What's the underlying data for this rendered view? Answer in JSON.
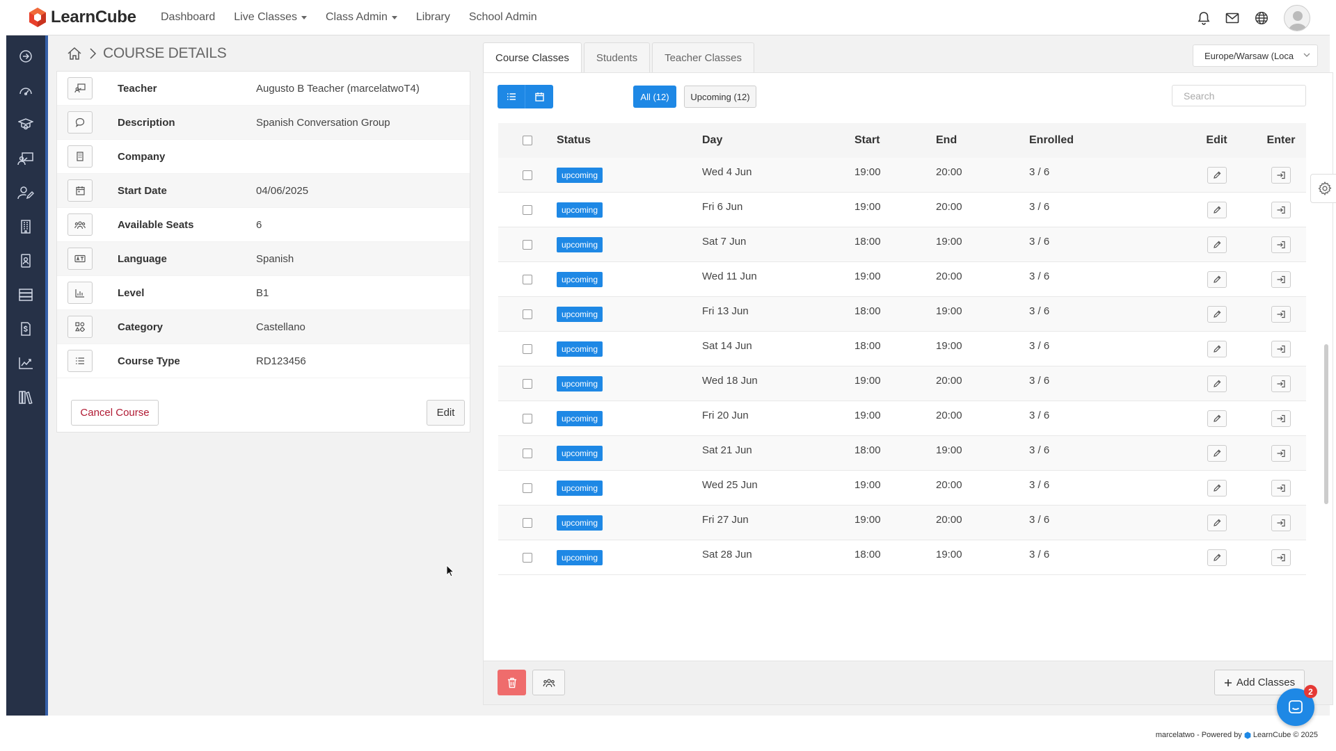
{
  "app": {
    "brand": "LearnCube",
    "accent": "#1e88e5",
    "sidebar_bg": "#263147"
  },
  "nav": {
    "items": [
      {
        "label": "Dashboard",
        "dropdown": false
      },
      {
        "label": "Live Classes",
        "dropdown": true
      },
      {
        "label": "Class Admin",
        "dropdown": true
      },
      {
        "label": "Library",
        "dropdown": false
      },
      {
        "label": "School Admin",
        "dropdown": false
      }
    ]
  },
  "top_icons": [
    "bell-icon",
    "mail-icon",
    "globe-icon",
    "avatar"
  ],
  "sidebar": {
    "icons": [
      "arrow-right-circle-icon",
      "dashboard-gauge-icon",
      "graduation-cap-icon",
      "teacher-board-icon",
      "user-edit-icon",
      "building-icon",
      "id-badge-icon",
      "server-list-icon",
      "dollar-document-icon",
      "chart-line-icon",
      "library-books-icon"
    ]
  },
  "breadcrumb": {
    "title": "COURSE DETAILS"
  },
  "details": {
    "rows": [
      {
        "icon": "teacher-icon",
        "label": "Teacher",
        "value": "Augusto B Teacher (marcelatwoT4)"
      },
      {
        "icon": "speech-bubble-icon",
        "label": "Description",
        "value": "Spanish Conversation Group"
      },
      {
        "icon": "building-icon",
        "label": "Company",
        "value": ""
      },
      {
        "icon": "calendar-icon",
        "label": "Start Date",
        "value": "04/06/2025"
      },
      {
        "icon": "group-icon",
        "label": "Available Seats",
        "value": "6"
      },
      {
        "icon": "language-icon",
        "label": "Language",
        "value": "Spanish"
      },
      {
        "icon": "bar-chart-icon",
        "label": "Level",
        "value": "B1"
      },
      {
        "icon": "category-icon",
        "label": "Category",
        "value": "Castellano"
      },
      {
        "icon": "list-icon",
        "label": "Course Type",
        "value": "RD123456"
      }
    ],
    "cancel_label": "Cancel Course",
    "edit_label": "Edit"
  },
  "tabs": [
    {
      "label": "Course Classes",
      "active": true
    },
    {
      "label": "Students",
      "active": false
    },
    {
      "label": "Teacher Classes",
      "active": false
    }
  ],
  "timezone": {
    "value": "Europe/Warsaw (Loca"
  },
  "filters": {
    "all": "All (12)",
    "upcoming": "Upcoming (12)"
  },
  "search": {
    "placeholder": "Search",
    "value": ""
  },
  "table": {
    "headers": {
      "status": "Status",
      "day": "Day",
      "start": "Start",
      "end": "End",
      "enrolled": "Enrolled",
      "edit": "Edit",
      "enter": "Enter"
    },
    "rows": [
      {
        "status": "upcoming",
        "day": "Wed 4 Jun",
        "start": "19:00",
        "end": "20:00",
        "enrolled": "3 / 6"
      },
      {
        "status": "upcoming",
        "day": "Fri 6 Jun",
        "start": "19:00",
        "end": "20:00",
        "enrolled": "3 / 6"
      },
      {
        "status": "upcoming",
        "day": "Sat 7 Jun",
        "start": "18:00",
        "end": "19:00",
        "enrolled": "3 / 6"
      },
      {
        "status": "upcoming",
        "day": "Wed 11 Jun",
        "start": "19:00",
        "end": "20:00",
        "enrolled": "3 / 6"
      },
      {
        "status": "upcoming",
        "day": "Fri 13 Jun",
        "start": "18:00",
        "end": "19:00",
        "enrolled": "3 / 6"
      },
      {
        "status": "upcoming",
        "day": "Sat 14 Jun",
        "start": "18:00",
        "end": "19:00",
        "enrolled": "3 / 6"
      },
      {
        "status": "upcoming",
        "day": "Wed 18 Jun",
        "start": "19:00",
        "end": "20:00",
        "enrolled": "3 / 6"
      },
      {
        "status": "upcoming",
        "day": "Fri 20 Jun",
        "start": "19:00",
        "end": "20:00",
        "enrolled": "3 / 6"
      },
      {
        "status": "upcoming",
        "day": "Sat 21 Jun",
        "start": "18:00",
        "end": "19:00",
        "enrolled": "3 / 6"
      },
      {
        "status": "upcoming",
        "day": "Wed 25 Jun",
        "start": "19:00",
        "end": "20:00",
        "enrolled": "3 / 6"
      },
      {
        "status": "upcoming",
        "day": "Fri 27 Jun",
        "start": "19:00",
        "end": "20:00",
        "enrolled": "3 / 6"
      },
      {
        "status": "upcoming",
        "day": "Sat 28 Jun",
        "start": "18:00",
        "end": "19:00",
        "enrolled": "3 / 6"
      }
    ]
  },
  "actions": {
    "add_classes": "Add Classes"
  },
  "chat": {
    "badge": "2"
  },
  "footer": {
    "user": "marcelatwo",
    "powered": "- Powered by",
    "brand": "LearnCube © 2025"
  }
}
